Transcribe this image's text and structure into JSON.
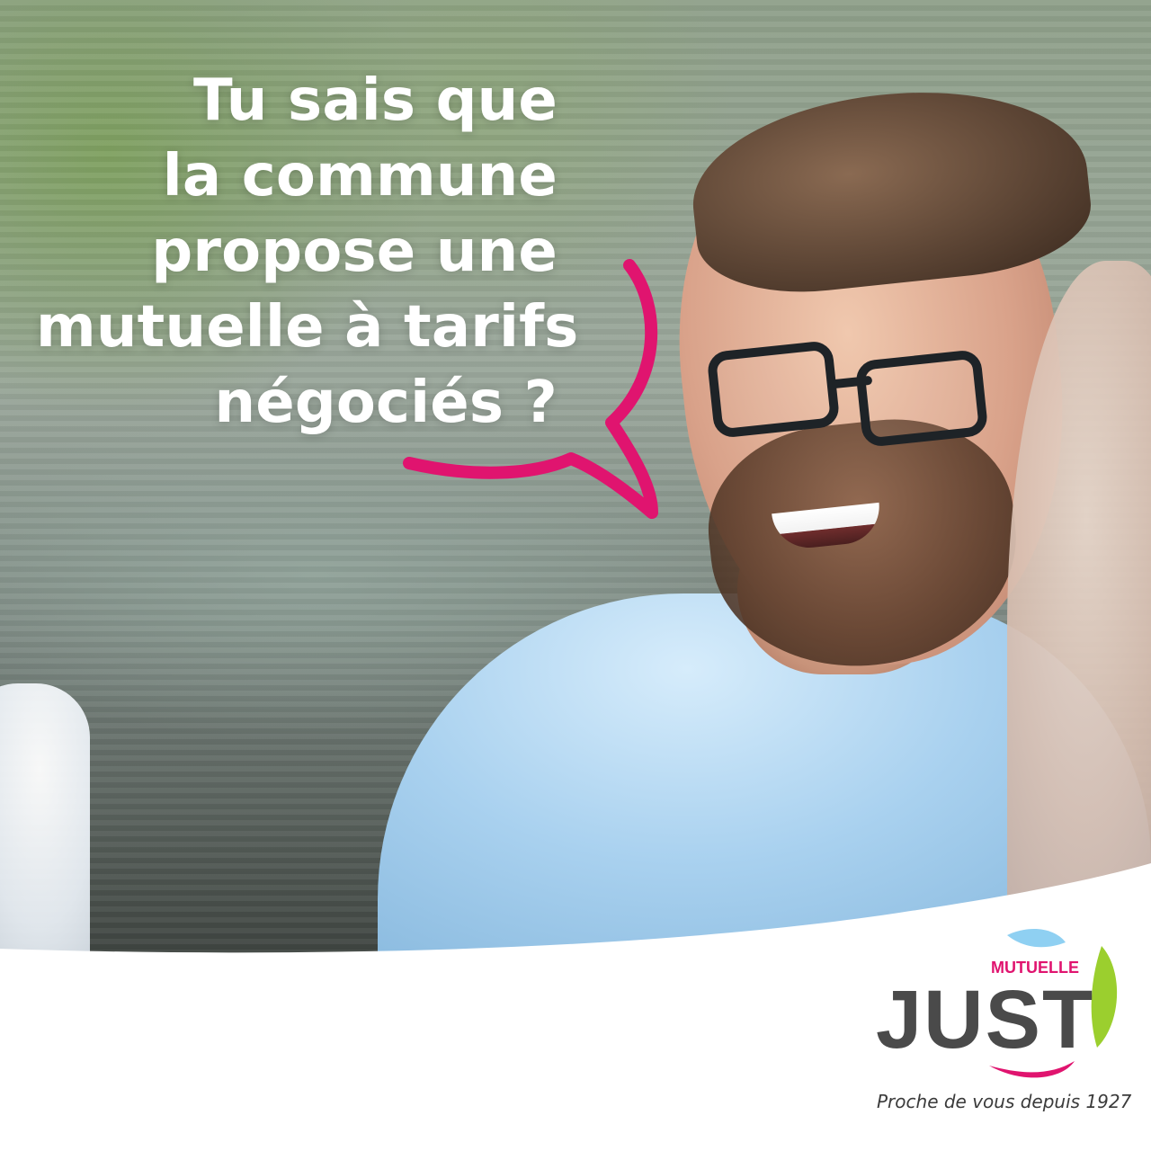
{
  "headline": {
    "lines": [
      "Tu sais que",
      "la commune",
      "propose une",
      "mutuelle à tarifs",
      "négociés ?"
    ]
  },
  "brand": {
    "mutuelle_label": "MUTUELLE",
    "name": "JUST",
    "tagline": "Proche de vous depuis 1927",
    "colors": {
      "pink": "#e0146f",
      "gray": "#4a4a4a",
      "green": "#9bcf2e",
      "light_blue": "#8fd0f2",
      "white": "#ffffff"
    }
  }
}
